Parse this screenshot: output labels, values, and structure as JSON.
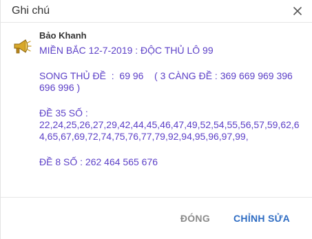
{
  "dialog": {
    "title": "Ghi chú"
  },
  "note": {
    "author": "Bảo Khanh",
    "lines": [
      "MIỀN BẮC 12-7-2019 : ĐỘC THỦ LÔ 99",
      "SONG THỦ ĐỀ  :  69 96    ( 3 CÀNG ĐỀ : 369 669 969 396 696 996 )",
      "ĐỀ 35 SỐ :",
      "22,24,25,26,27,29,42,44,45,46,47,49,52,54,55,56,57,59,62,64,65,67,69,72,74,75,76,77,79,92,94,95,96,97,99,",
      "ĐỀ 8 SỐ : 262 464 565 676"
    ]
  },
  "footer": {
    "close_label": "ĐÓNG",
    "edit_label": "CHỈNH SỬA"
  },
  "icons": {
    "close": "close-icon",
    "avatar": "megaphone-icon"
  },
  "colors": {
    "note_text": "#5b3fc7",
    "primary_button": "#2e6cc3",
    "secondary_button": "#8a8a8a"
  }
}
